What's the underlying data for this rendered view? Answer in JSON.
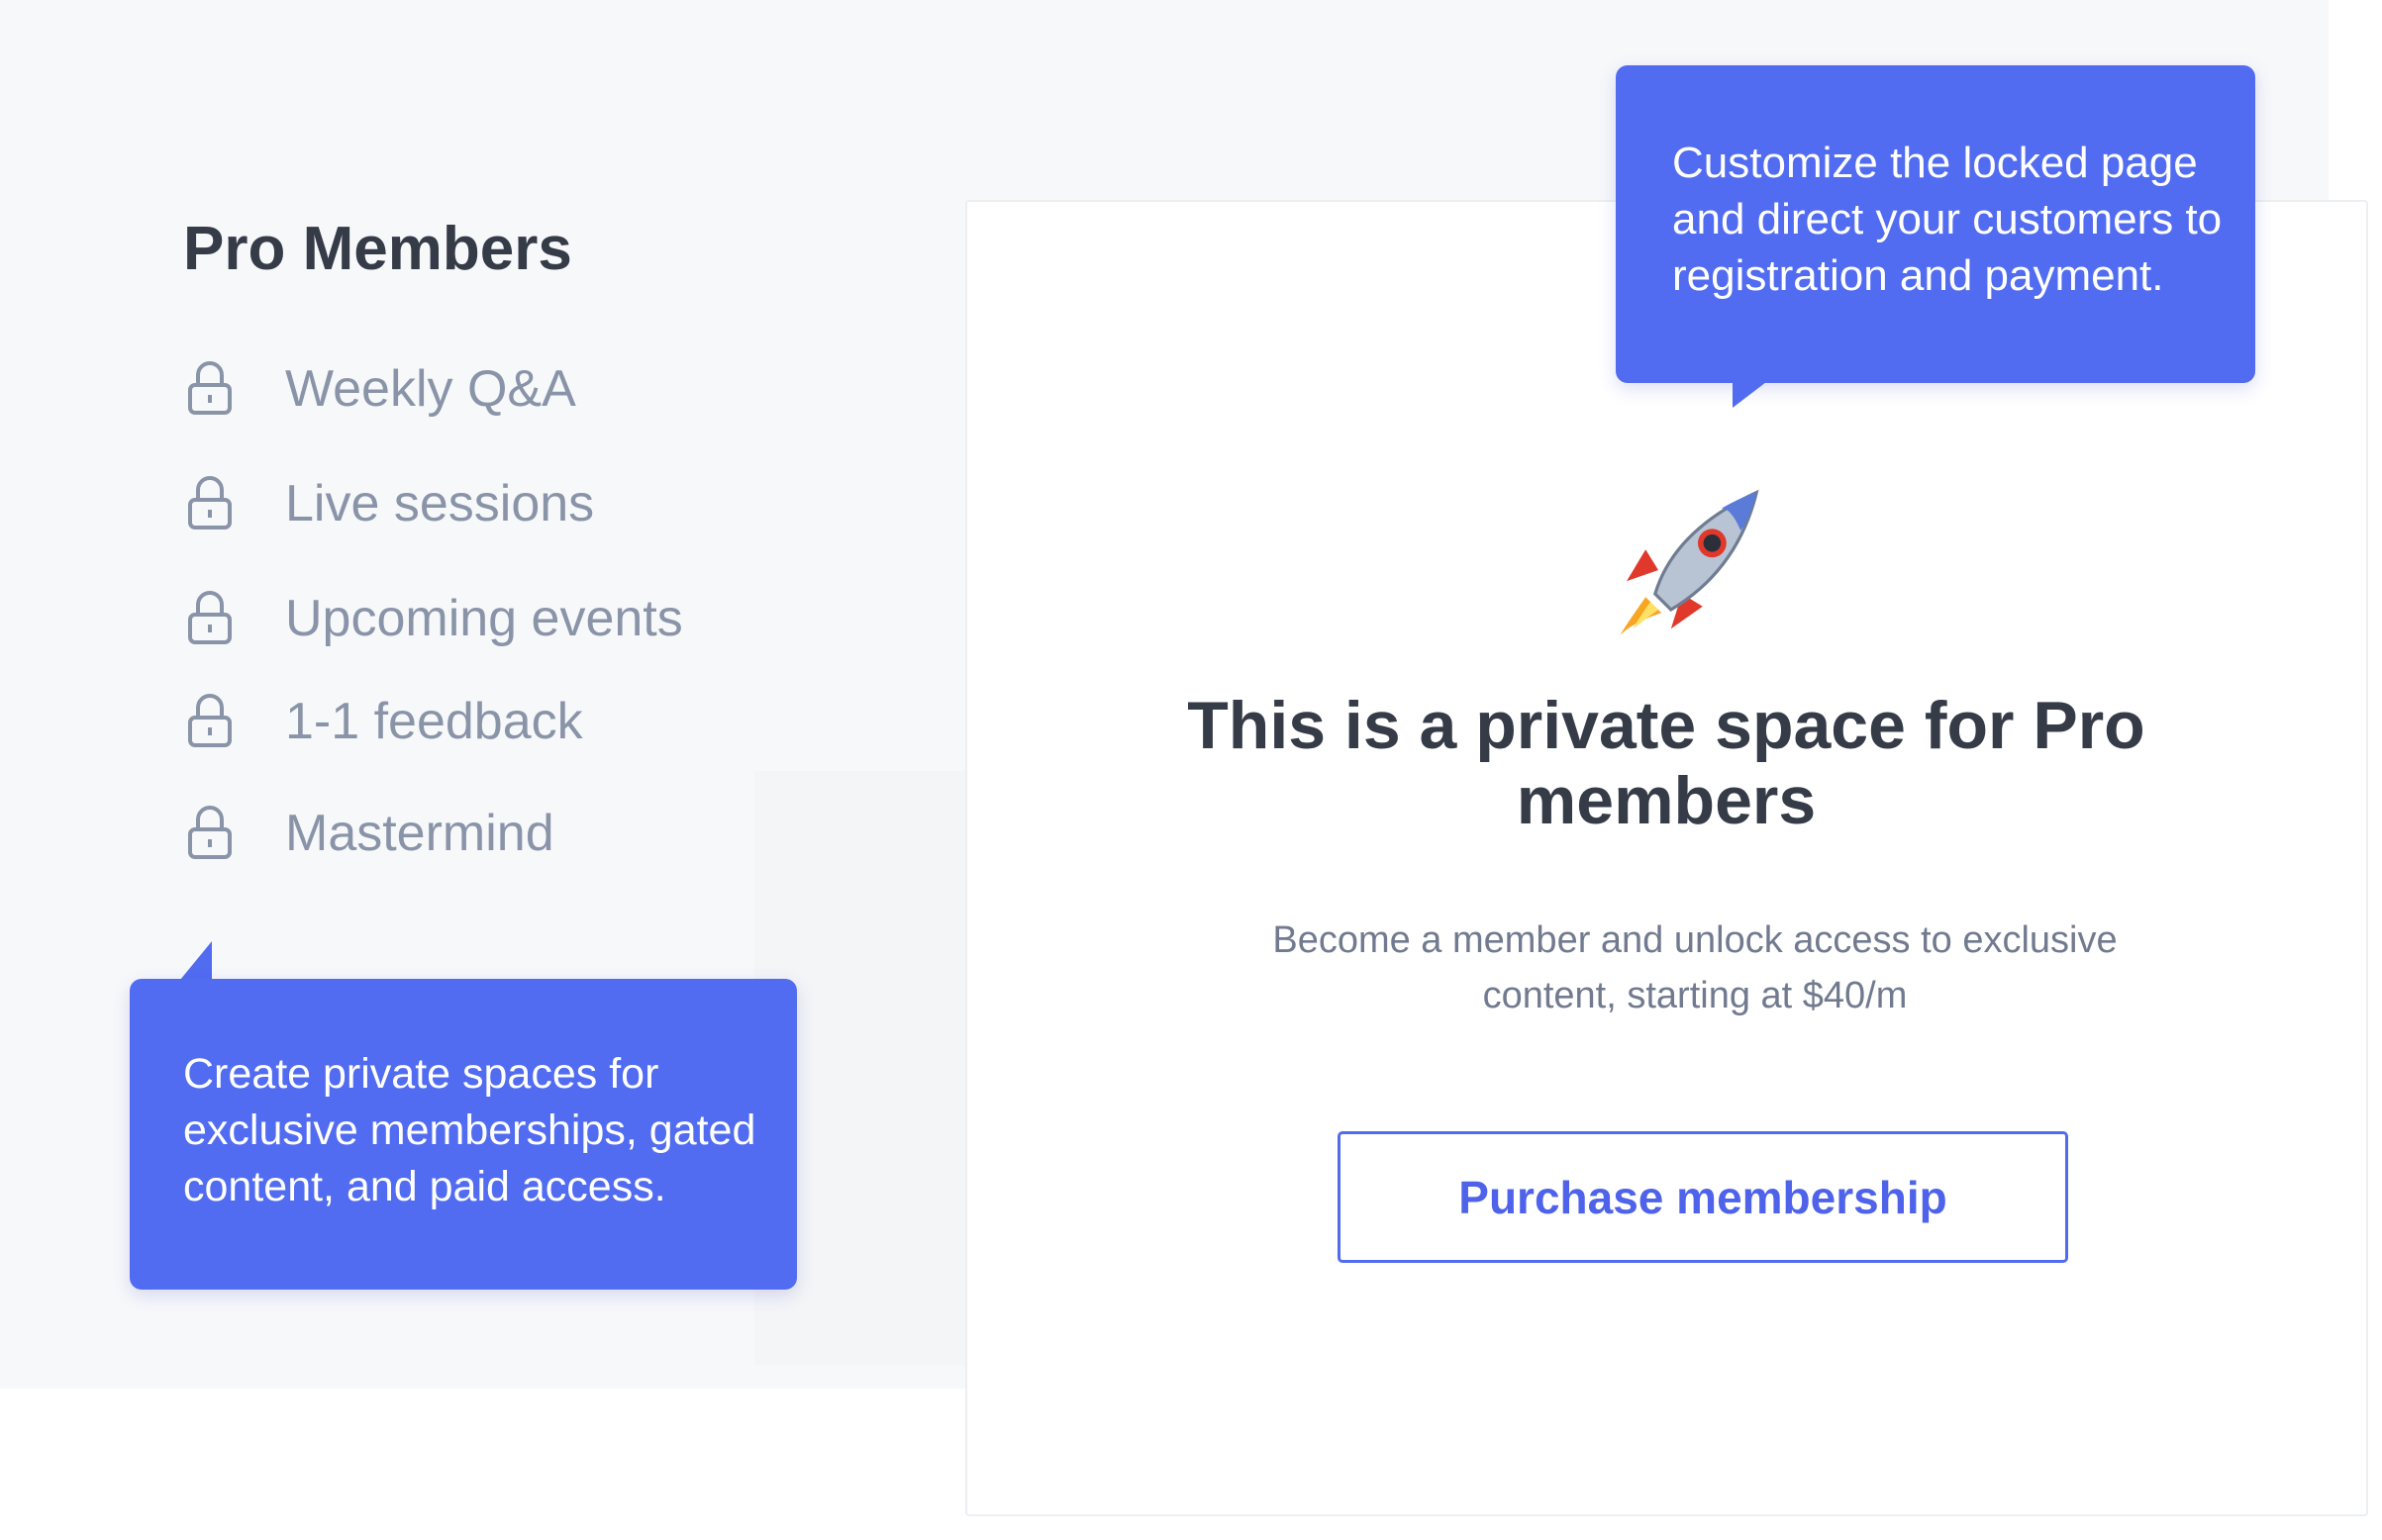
{
  "sidebar": {
    "title": "Pro Members",
    "items": [
      {
        "label": "Weekly Q&A",
        "icon": "lock-icon"
      },
      {
        "label": "Live sessions",
        "icon": "lock-icon"
      },
      {
        "label": "Upcoming events",
        "icon": "lock-icon"
      },
      {
        "label": "1-1 feedback",
        "icon": "lock-icon"
      },
      {
        "label": "Mastermind",
        "icon": "lock-icon"
      }
    ]
  },
  "tooltips": {
    "top": "Customize the locked page and direct your customers to registration and payment.",
    "bottom": "Create private spaces for exclusive memberships, gated content, and paid access."
  },
  "card": {
    "icon": "rocket-icon",
    "headline": "This is a private space for Pro members",
    "description": "Become a member and unlock access to exclusive content, starting at $40/m",
    "button_label": "Purchase membership"
  },
  "colors": {
    "accent": "#516cf0",
    "panel_bg": "#f7f8fa",
    "muted_text": "#8a94a8",
    "heading_text": "#353b47"
  }
}
